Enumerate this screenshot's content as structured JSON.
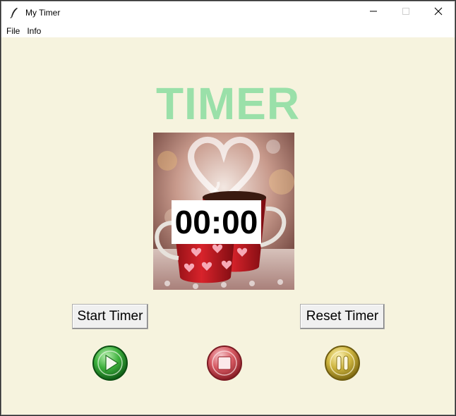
{
  "window": {
    "title": "My Timer"
  },
  "menu": {
    "items": [
      "File",
      "Info"
    ]
  },
  "main": {
    "heading": "TIMER",
    "time_display": "00:00",
    "start_label": "Start Timer",
    "reset_label": "Reset Timer"
  },
  "icons": {
    "app": "feather-icon",
    "minimize": "minimize-icon",
    "maximize": "maximize-icon",
    "close": "close-icon",
    "play": "play-icon",
    "stop": "stop-icon",
    "pause": "pause-icon",
    "image": "coffee-cup-image"
  },
  "colors": {
    "background": "#f6f3de",
    "heading": "#9ae0a9",
    "play": "#2e9c2e",
    "stop": "#c0444a",
    "pause": "#c9b23c"
  }
}
